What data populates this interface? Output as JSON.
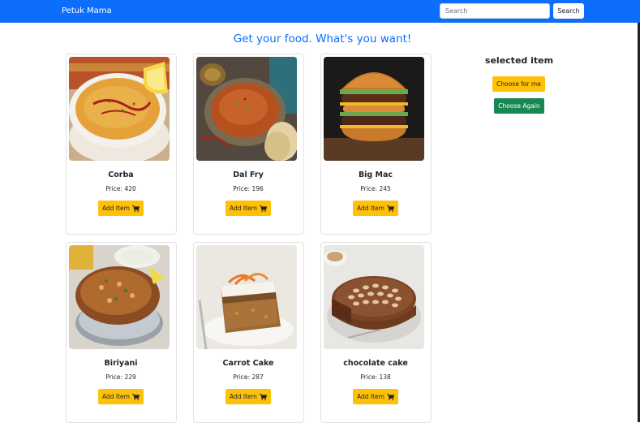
{
  "navbar": {
    "brand": "Petuk Mama",
    "search": {
      "placeholder": "Search",
      "button_label": "Search"
    },
    "color": "#0d6efd"
  },
  "headline": "Get your food. What's you want!",
  "foods": [
    {
      "name": "Corba",
      "price": "Price: 420",
      "button_label": "Add Item",
      "image": "lentil-soup-photo"
    },
    {
      "name": "Dal Fry",
      "price": "Price: 196",
      "button_label": "Add Item",
      "image": "dal-fry-photo"
    },
    {
      "name": "Big Mac",
      "price": "Price: 245",
      "button_label": "Add Item",
      "image": "burger-photo"
    },
    {
      "name": "Biriyani",
      "price": "Price: 229",
      "button_label": "Add Item",
      "image": "biriyani-photo"
    },
    {
      "name": "Carrot Cake",
      "price": "Price: 287",
      "button_label": "Add Item",
      "image": "carrot-cake-photo"
    },
    {
      "name": "chocolate cake",
      "price": "Price: 138",
      "button_label": "Add Item",
      "image": "chocolate-cake-photo"
    }
  ],
  "sidebar": {
    "title": "selected item",
    "choose_label": "Choose for me",
    "again_label": "Choose Again"
  },
  "colors": {
    "accent": "#0d6efd",
    "add_button": "#ffc107",
    "again_button": "#198754"
  }
}
